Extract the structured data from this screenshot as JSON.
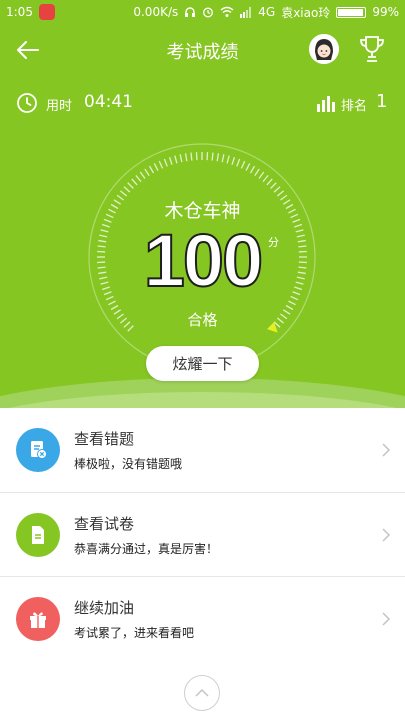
{
  "status_bar": {
    "time": "1:05",
    "speed": "0.00K/s",
    "network": "4G",
    "carrier": "袁xiao玲",
    "battery": "99%"
  },
  "header": {
    "title": "考试成绩"
  },
  "summary": {
    "time_label": "用时",
    "time_value": "04:41",
    "rank_label": "排名",
    "rank_value": "1"
  },
  "result": {
    "title": "木仓车神",
    "score": "100",
    "unit": "分",
    "grade": "合格",
    "score_fraction": 1.0,
    "share_label": "炫耀一下"
  },
  "menu": [
    {
      "title": "查看错题",
      "subtitle": "棒极啦，没有错题哦",
      "icon": "wrong-questions-icon",
      "color": "#3aa7e6"
    },
    {
      "title": "查看试卷",
      "subtitle": "恭喜满分通过，真是厉害！",
      "icon": "exam-paper-icon",
      "color": "#86c623"
    },
    {
      "title": "继续加油",
      "subtitle": "考试累了，进来看看吧",
      "icon": "gift-icon",
      "color": "#f0605e"
    }
  ],
  "colors": {
    "primary": "#86c623",
    "blue": "#3aa7e6",
    "red": "#f0605e"
  }
}
